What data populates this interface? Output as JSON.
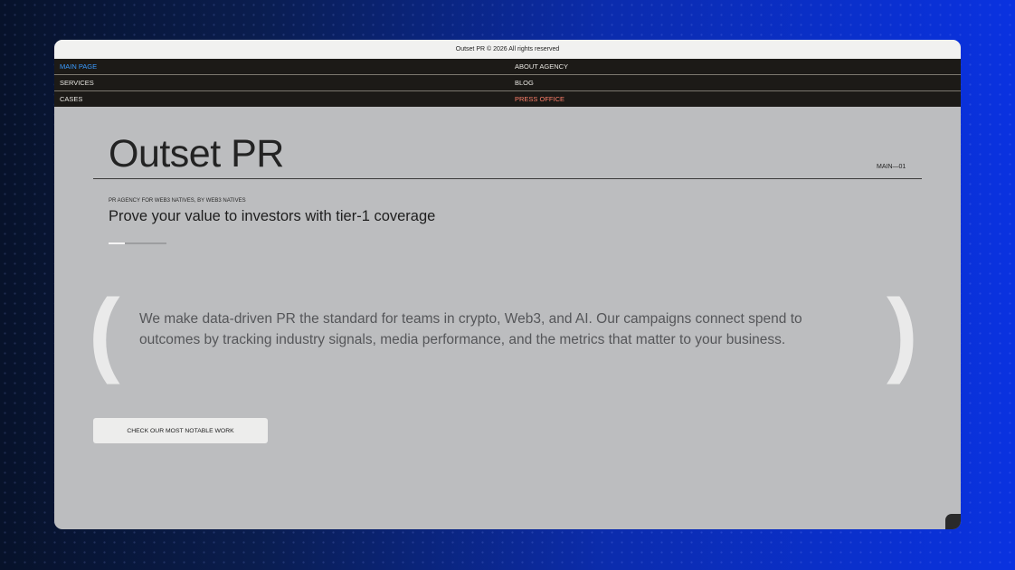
{
  "topbar": {
    "copyright": "Outset PR © 2026 All rights reserved"
  },
  "nav": {
    "rows": [
      {
        "left": "MAIN PAGE",
        "right": "ABOUT AGENCY"
      },
      {
        "left": "SERVICES",
        "right": "BLOG"
      },
      {
        "left": "CASES",
        "right": "PRESS OFFICE"
      }
    ],
    "active_color": "#3a9bff",
    "accent_color": "#ff7f6a"
  },
  "hero": {
    "title": "Outset PR",
    "code": "MAIN—01",
    "tagline": "PR AGENCY FOR WEB3 NATIVES, BY WEB3 NATIVES",
    "subtitle": "Prove your value to investors with tier-1 coverage",
    "slide_progress": 0.28
  },
  "quote": {
    "open_bracket": "(",
    "close_bracket": ")",
    "text": "We make data-driven PR the standard for teams in crypto, Web3, and AI. Our campaigns connect spend to outcomes by tracking industry signals, media performance, and the metrics that matter to your business."
  },
  "cta": {
    "label": "CHECK OUR MOST NOTABLE WORK"
  },
  "colors": {
    "panel": "#bcbdbf",
    "nav_bg": "#1c1a17",
    "background_accent": "#0a32e0"
  }
}
